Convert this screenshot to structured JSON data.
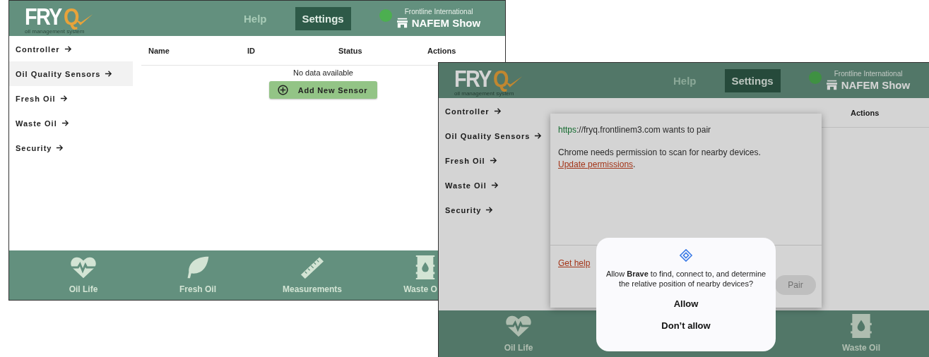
{
  "windows": [
    {
      "logo": {
        "word": "FRY",
        "letter": "Q",
        "tagline": "oil management system"
      },
      "nav": [
        {
          "label": "Help",
          "selected": false
        },
        {
          "label": "Settings",
          "selected": true
        }
      ],
      "account": {
        "company": "Frontline International",
        "store": "NAFEM Show"
      },
      "sidebar": {
        "items": [
          {
            "label": "Controller",
            "selected": false
          },
          {
            "label": "Oil Quality Sensors",
            "selected": true
          },
          {
            "label": "Fresh Oil",
            "selected": false
          },
          {
            "label": "Waste Oil",
            "selected": false
          },
          {
            "label": "Security",
            "selected": false
          }
        ]
      },
      "table": {
        "columns": [
          "Name",
          "ID",
          "Status",
          "Actions"
        ],
        "empty_message": "No data available"
      },
      "add_button": "Add New Sensor",
      "bottom_nav": [
        {
          "kind": "heart",
          "label": "Oil Life"
        },
        {
          "kind": "leaf",
          "label": "Fresh Oil"
        },
        {
          "kind": "ruler",
          "label": "Measurements"
        },
        {
          "kind": "barrel",
          "label": "Waste O"
        }
      ]
    },
    {
      "logo": {
        "word": "FRY",
        "letter": "Q",
        "tagline": "oil management system"
      },
      "nav": [
        {
          "label": "Help",
          "selected": false
        },
        {
          "label": "Settings",
          "selected": true
        }
      ],
      "account": {
        "company": "Frontline International",
        "store": "NAFEM Show"
      },
      "sidebar": {
        "items": [
          {
            "label": "Controller",
            "selected": false
          },
          {
            "label": "Oil Quality Sensors",
            "selected": false
          },
          {
            "label": "Fresh Oil",
            "selected": false
          },
          {
            "label": "Waste Oil",
            "selected": false
          },
          {
            "label": "Security",
            "selected": false
          }
        ]
      },
      "table": {
        "columns": [
          "Actions"
        ]
      },
      "bottom_nav": [
        {
          "kind": "heart",
          "label": "Oil Life"
        },
        {
          "kind": "barrel",
          "label": "Waste Oil"
        }
      ],
      "dimmed": true,
      "pair_dialog": {
        "scheme": "https",
        "origin": "://fryq.frontlinem3.com wants to pair",
        "message": "Chrome needs permission to scan for nearby devices.",
        "link": "Update permissions",
        "link_end": ".",
        "help_link": "Get help",
        "pair_button": {
          "label": "Pair",
          "disabled": true
        }
      },
      "permission_dialog": {
        "question": "Allow **Brave** to find, connect to, and determine the relative position of nearby devices?",
        "buttons": [
          "Allow",
          "Don’t allow"
        ]
      }
    }
  ]
}
